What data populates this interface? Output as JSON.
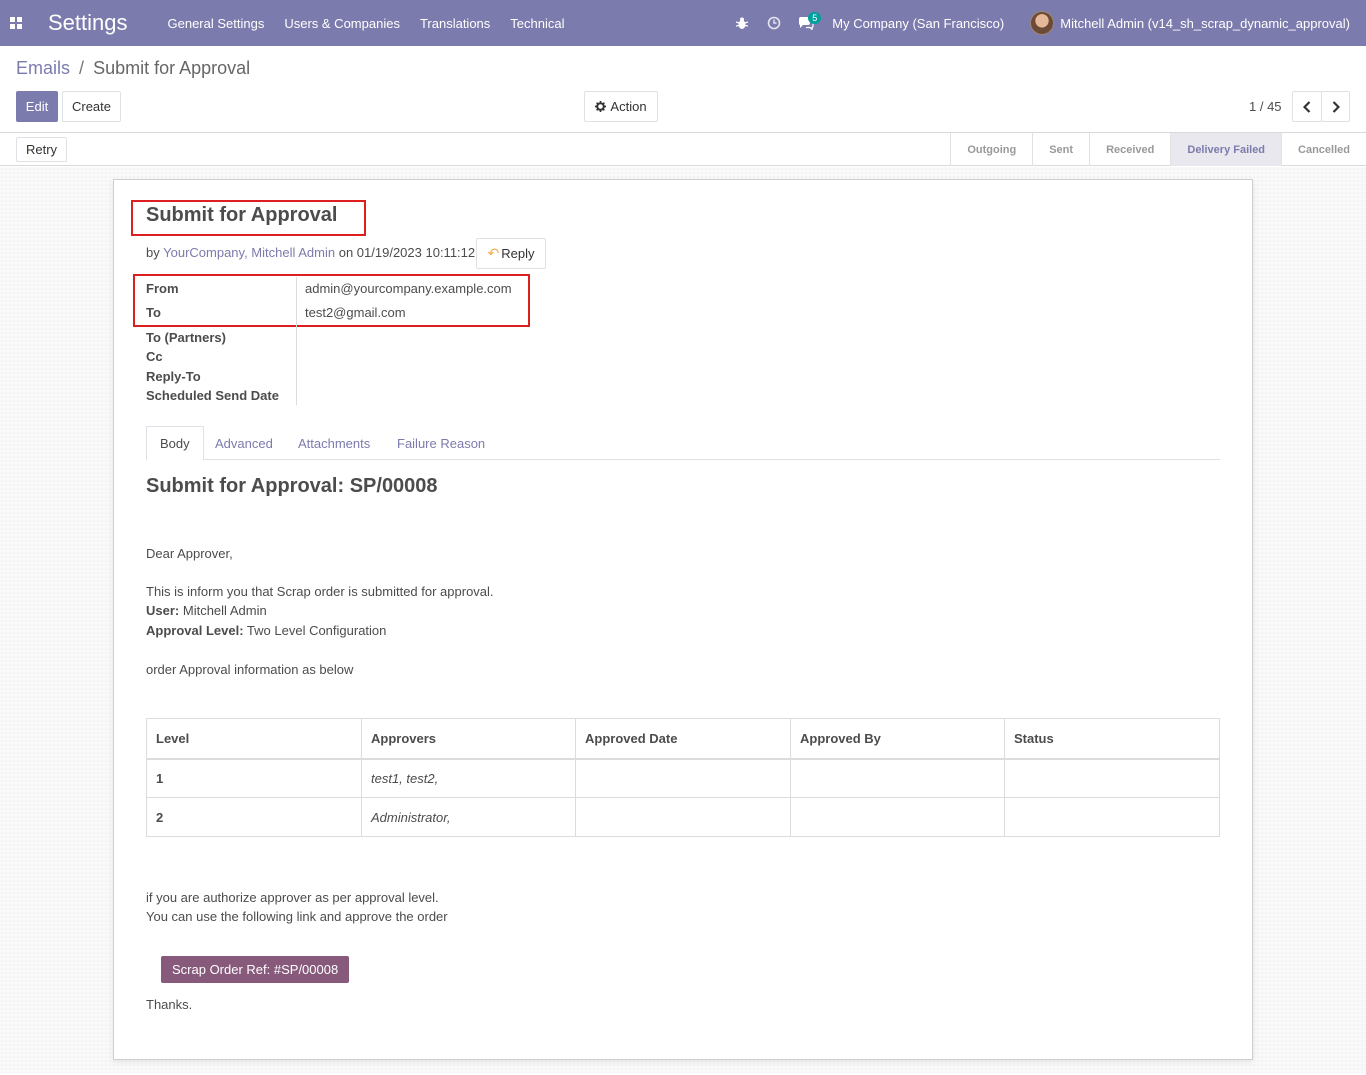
{
  "navbar": {
    "brand": "Settings",
    "menu": [
      "General Settings",
      "Users & Companies",
      "Translations",
      "Technical"
    ],
    "message_count": "5",
    "company": "My Company (San Francisco)",
    "user": "Mitchell Admin (v14_sh_scrap_dynamic_approval)"
  },
  "breadcrumb": {
    "parent": "Emails",
    "separator": "/",
    "current": "Submit for Approval"
  },
  "controls": {
    "edit_label": "Edit",
    "create_label": "Create",
    "action_label": "Action",
    "pager": "1 / 45",
    "retry_label": "Retry"
  },
  "stages": [
    "Outgoing",
    "Sent",
    "Received",
    "Delivery Failed",
    "Cancelled"
  ],
  "active_stage": "Delivery Failed",
  "message": {
    "subject": "Submit for Approval",
    "by_prefix": "by",
    "authors": "YourCompany, Mitchell Admin",
    "date_text": "on 01/19/2023 10:11:12",
    "reply_label": "Reply",
    "fields": [
      {
        "label": "From",
        "value": "admin@yourcompany.example.com"
      },
      {
        "label": "To",
        "value": "test2@gmail.com"
      },
      {
        "label": "To (Partners)",
        "value": ""
      },
      {
        "label": "Cc",
        "value": ""
      },
      {
        "label": "Reply-To",
        "value": ""
      },
      {
        "label": "Scheduled Send Date",
        "value": ""
      }
    ]
  },
  "tabs": [
    "Body",
    "Advanced",
    "Attachments",
    "Failure Reason"
  ],
  "body": {
    "heading": "Submit for Approval: SP/00008",
    "greeting": "Dear Approver,",
    "intro": "This is inform you that Scrap order is submitted for approval.",
    "user_label": "User:",
    "user_value": "Mitchell Admin",
    "level_label": "Approval Level:",
    "level_value": "Two Level Configuration",
    "info_line": "order Approval information as below",
    "table": {
      "headers": [
        "Level",
        "Approvers",
        "Approved Date",
        "Approved By",
        "Status"
      ],
      "rows": [
        [
          "1",
          "test1, test2,",
          "",
          "",
          ""
        ],
        [
          "2",
          "Administrator,",
          "",
          "",
          ""
        ]
      ]
    },
    "footer_line1": "if you are authorize approver as per approval level.",
    "footer_line2": "You can use the following link and approve the order",
    "scrap_button": "Scrap Order Ref: #SP/00008",
    "thanks": "Thanks."
  },
  "colors": {
    "navbar": "#7c7bad",
    "primary": "#7c7bad",
    "scrap_button": "#875a7b",
    "highlight_box": "#dd1f1f"
  }
}
